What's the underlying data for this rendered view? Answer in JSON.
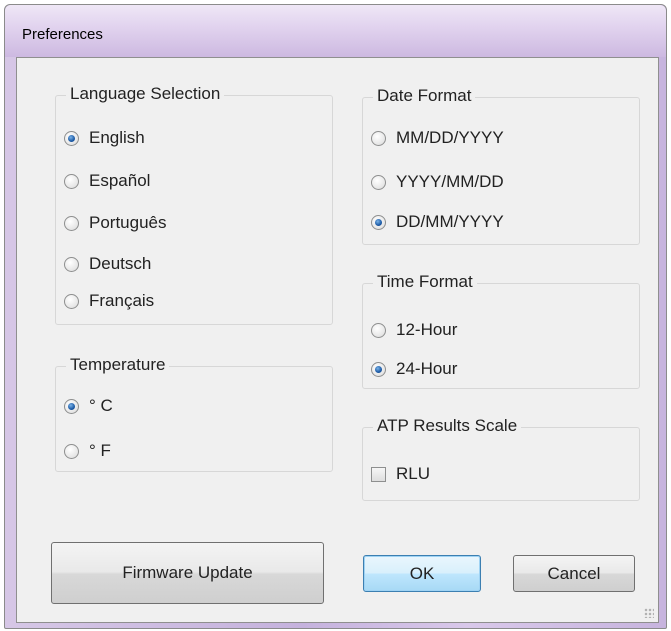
{
  "window": {
    "title": "Preferences"
  },
  "language": {
    "legend": "Language Selection",
    "options": [
      "English",
      "Español",
      "Português",
      "Deutsch",
      "Français"
    ],
    "selected": "English"
  },
  "temperature": {
    "legend": "Temperature",
    "options": [
      "° C",
      "° F"
    ],
    "selected": "° C"
  },
  "date_format": {
    "legend": "Date Format",
    "options": [
      "MM/DD/YYYY",
      "YYYY/MM/DD",
      "DD/MM/YYYY"
    ],
    "selected": "DD/MM/YYYY"
  },
  "time_format": {
    "legend": "Time Format",
    "options": [
      "12-Hour",
      "24-Hour"
    ],
    "selected": "24-Hour"
  },
  "atp": {
    "legend": "ATP Results Scale",
    "checkbox_label": "RLU",
    "checked": false
  },
  "buttons": {
    "firmware": "Firmware Update",
    "ok": "OK",
    "cancel": "Cancel"
  },
  "colors": {
    "title_bar": "#d6c7e6",
    "client_bg": "#f0f0f0",
    "default_button_border": "#3c7fb1",
    "radio_selected": "#1c5aa6"
  }
}
